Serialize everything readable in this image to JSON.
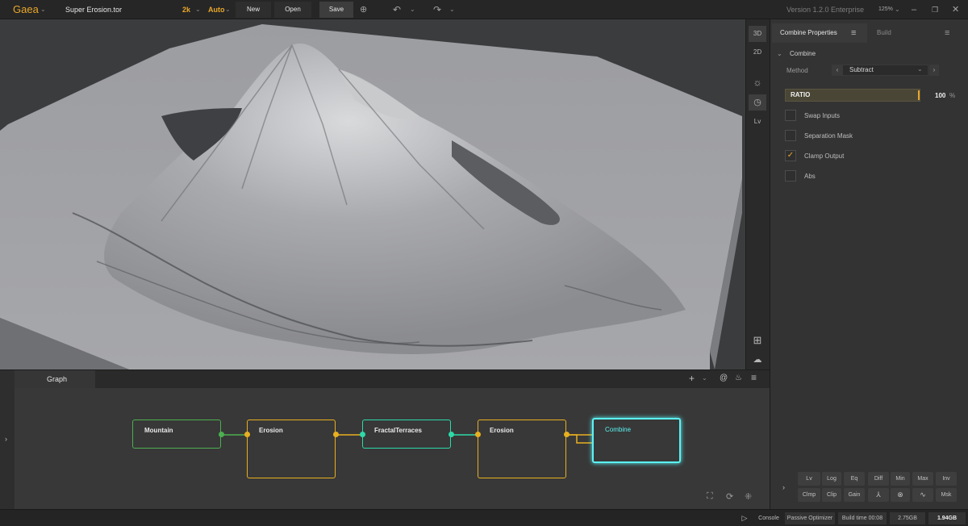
{
  "topbar": {
    "app_name": "Gaea",
    "file_name": "Super Erosion.tor",
    "resolution": "2k",
    "mode": "Auto",
    "new_label": "New",
    "open_label": "Open",
    "save_label": "Save",
    "version": "Version 1.2.0 Enterprise",
    "zoom": "125%"
  },
  "viewport_tools": {
    "view3d": "3D",
    "view2d": "2D",
    "lv": "Lv"
  },
  "panel": {
    "tab_properties": "Combine Properties",
    "tab_build": "Build",
    "section": "Combine",
    "method_label": "Method",
    "method_value": "Subtract",
    "ratio_label": "RATIO",
    "ratio_value": "100",
    "ratio_unit": "%",
    "options": [
      {
        "label": "Swap Inputs",
        "checked": false
      },
      {
        "label": "Separation Mask",
        "checked": false
      },
      {
        "label": "Clamp Output",
        "checked": true
      },
      {
        "label": "Abs",
        "checked": false
      }
    ],
    "mini_row1": [
      "Lv",
      "Log",
      "Eq",
      "Diff",
      "Min",
      "Max",
      "Inv"
    ],
    "mini_row2": [
      "Clmp",
      "Clip",
      "Gain",
      "",
      "",
      "",
      "Msk"
    ]
  },
  "graph": {
    "tab": "Graph",
    "nodes": [
      {
        "title": "Mountain",
        "color": "#4caf50"
      },
      {
        "title": "Erosion",
        "color": "#e8b020"
      },
      {
        "title": "FractalTerraces",
        "color": "#2dd9a8"
      },
      {
        "title": "Erosion",
        "color": "#e8b020"
      },
      {
        "title": "Combine",
        "color": "#5cf2f2"
      }
    ]
  },
  "status": {
    "console": "Console",
    "optimizer": "Passive Optimizer",
    "build_time": "Build time 00:08",
    "mem1": "2.75GB",
    "mem2": "1.94GB"
  },
  "colors": {
    "accent": "#e8a72c",
    "background": "#2b2b2b"
  }
}
